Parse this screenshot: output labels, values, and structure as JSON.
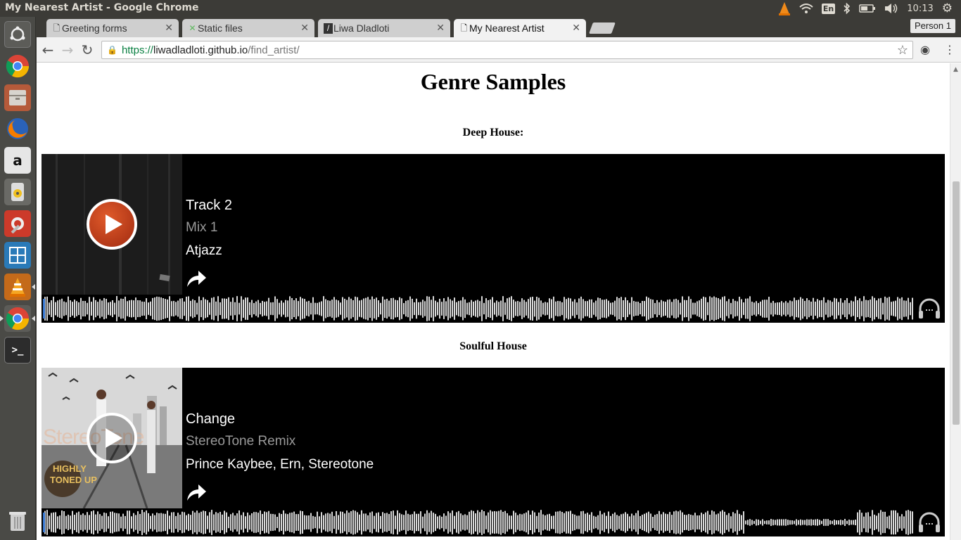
{
  "os": {
    "window_title": "My Nearest Artist - Google Chrome",
    "keyboard_layout": "En",
    "clock": "10:13",
    "launcher": [
      "dash-icon",
      "chrome-icon",
      "files-icon",
      "firefox-icon",
      "amazon-icon",
      "rhythmbox-icon",
      "settings-icon",
      "workspace-icon",
      "vlc-icon",
      "chrome-icon",
      "terminal-icon",
      "trash-icon"
    ]
  },
  "browser": {
    "tabs": [
      {
        "label": "Greeting forms",
        "favicon": "page-icon",
        "active": false
      },
      {
        "label": "Static files",
        "favicon": "django-icon",
        "active": false
      },
      {
        "label": "Liwa Dladloti",
        "favicon": "site-icon",
        "active": false
      },
      {
        "label": "My Nearest Artist",
        "favicon": "page-icon",
        "active": true
      }
    ],
    "profile_button": "Person 1",
    "url": {
      "scheme": "https://",
      "host": "liwadladloti.github.io",
      "path": "/find_artist/"
    }
  },
  "page": {
    "heading": "Genre Samples",
    "sections": [
      {
        "genre": "Deep House:",
        "track": {
          "title": "Track 2",
          "mix": "Mix 1",
          "artist": "Atjazz"
        },
        "play_style": "orange"
      },
      {
        "genre": "Soulful House",
        "track": {
          "title": "Change",
          "mix": "StereoTone Remix",
          "artist": "Prince Kaybee, Ern, Stereotone"
        },
        "play_style": "clear",
        "artwork_text": {
          "brand": "StereoTone",
          "album_line1": "HIGHLY",
          "album_line2": "TONED UP"
        }
      }
    ]
  },
  "colors": {
    "panel": "#3c3b37",
    "secure_green": "#0b8043",
    "player_bg": "#000000",
    "wave_progress": "#3a7bd5"
  }
}
